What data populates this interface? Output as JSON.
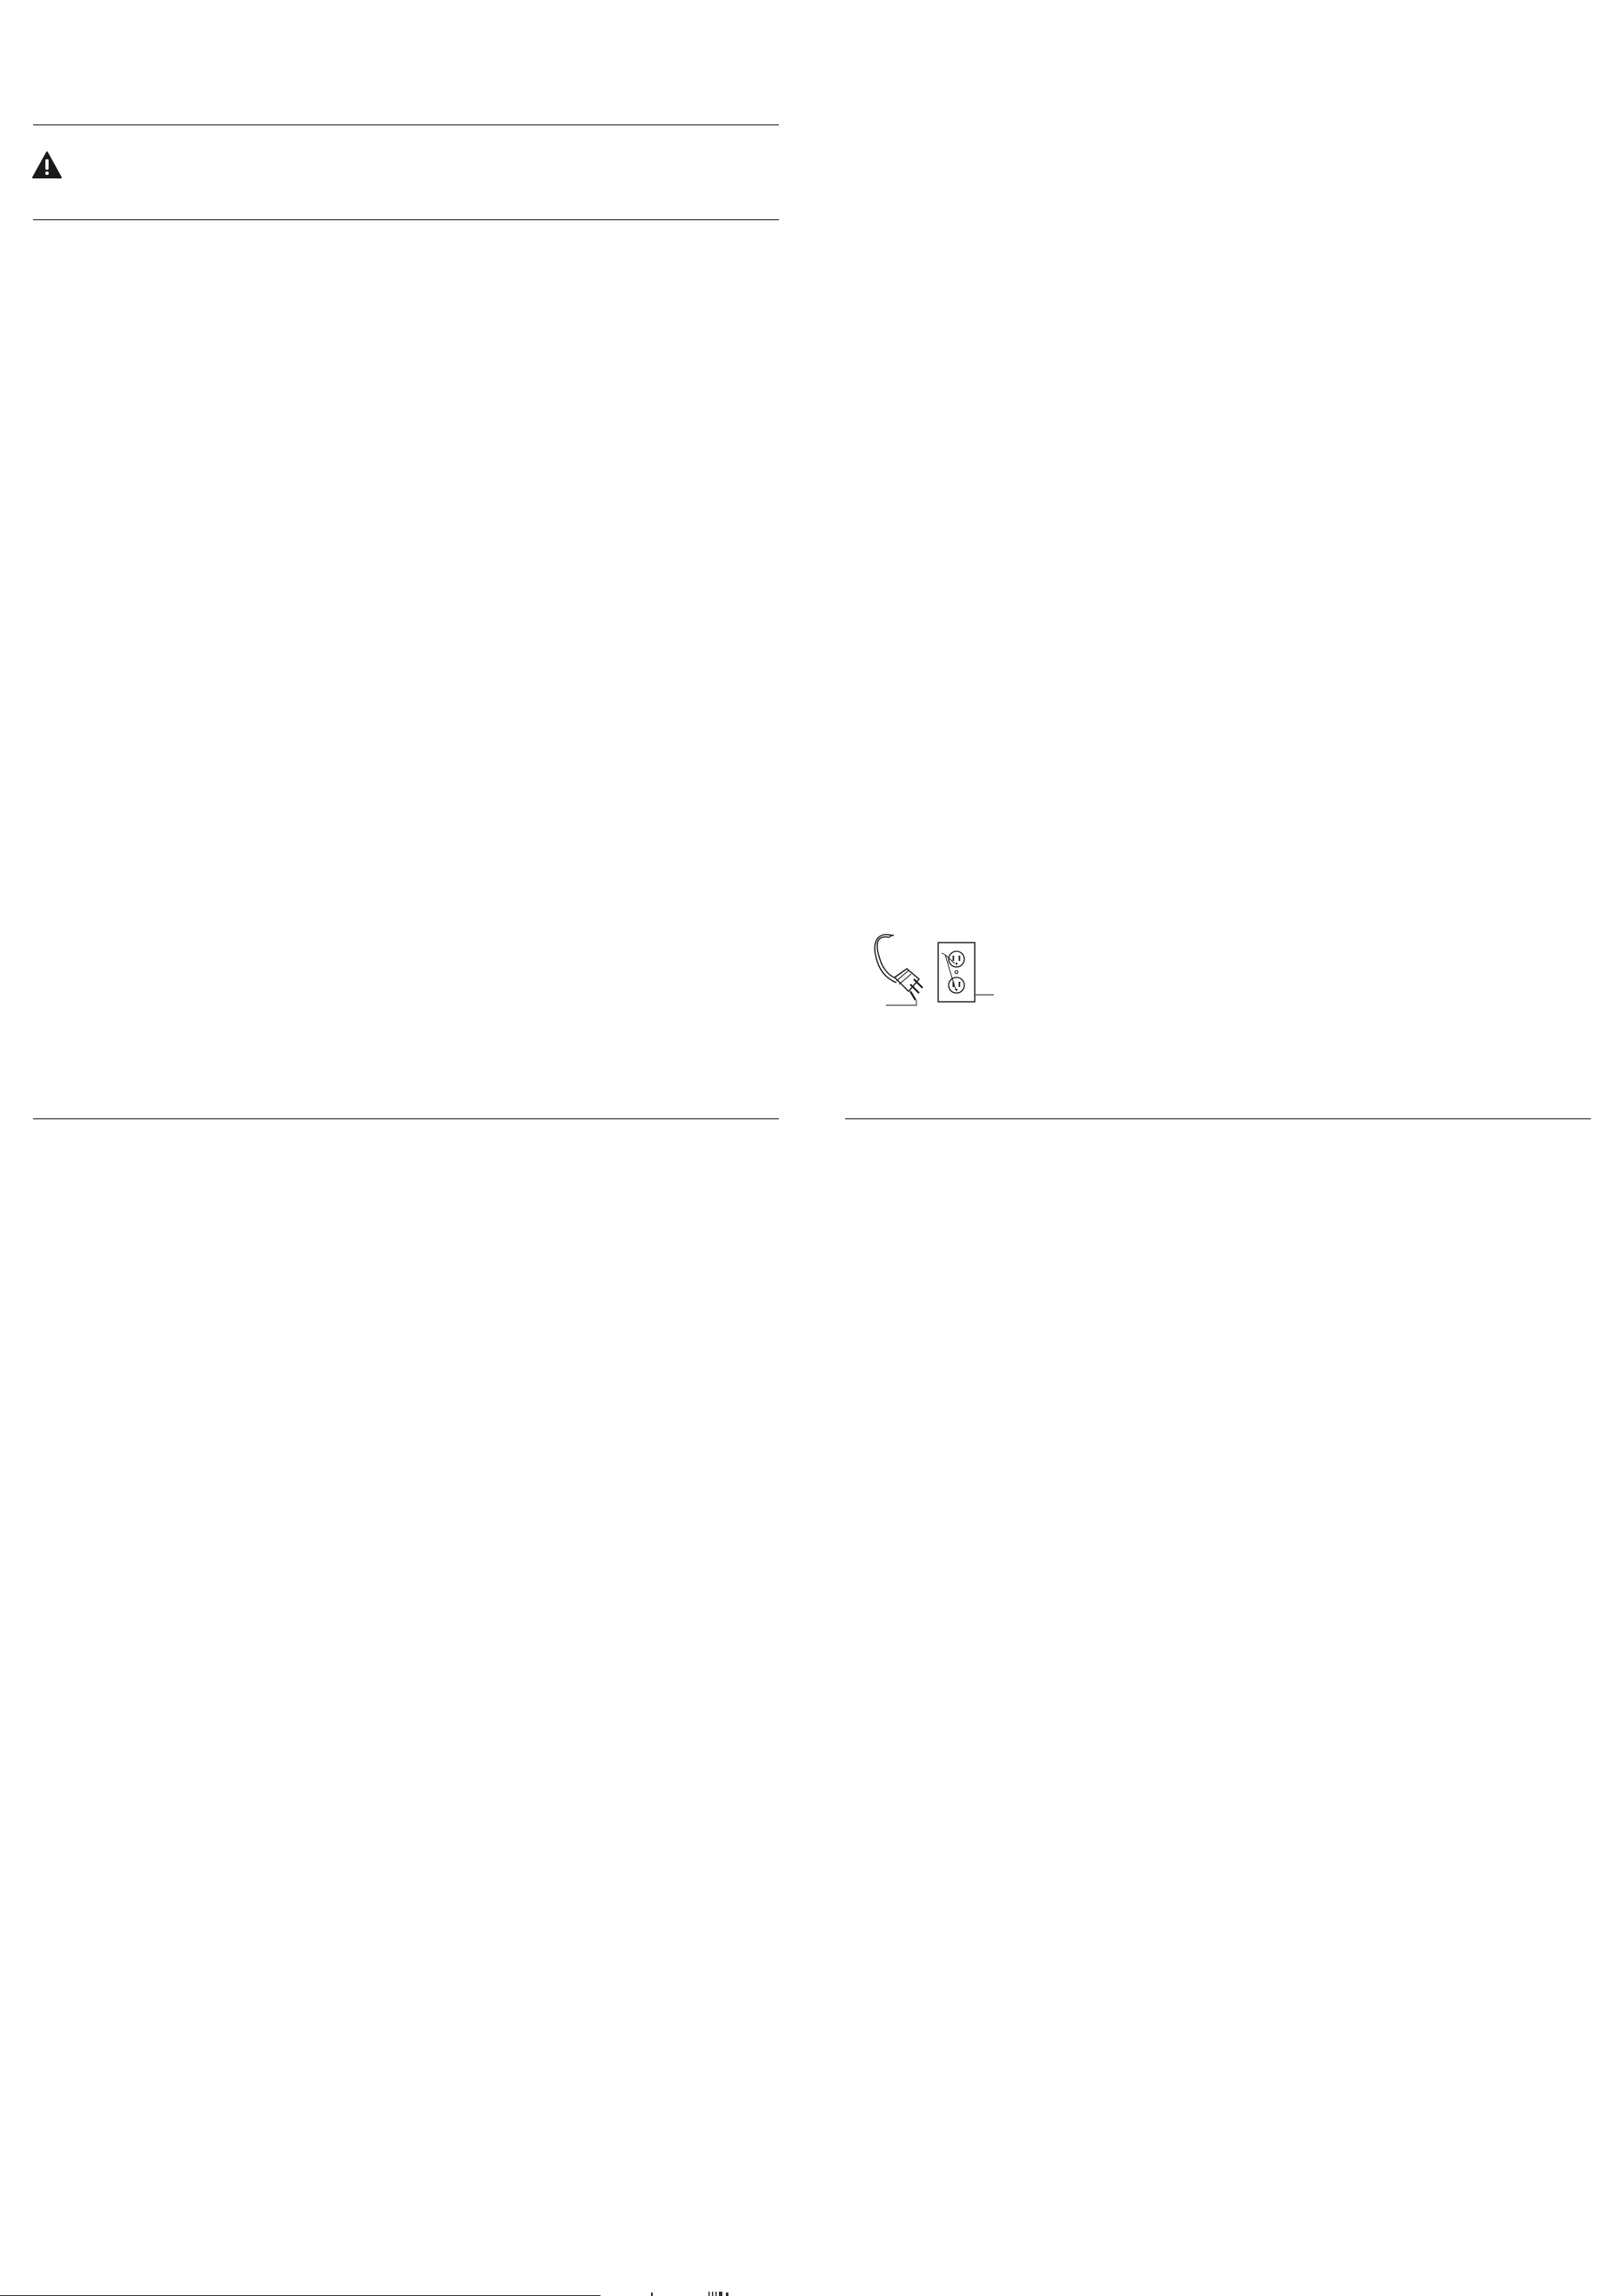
{
  "document": {
    "left_page": {
      "warning": {
        "icon": "warning-triangle-icon",
        "text": ""
      }
    },
    "right_page": {
      "figure": {
        "icon": "grounded-plug-and-outlet-illustration"
      }
    },
    "colors": {
      "ink": "#1a1a1a",
      "paper": "#ffffff"
    }
  }
}
